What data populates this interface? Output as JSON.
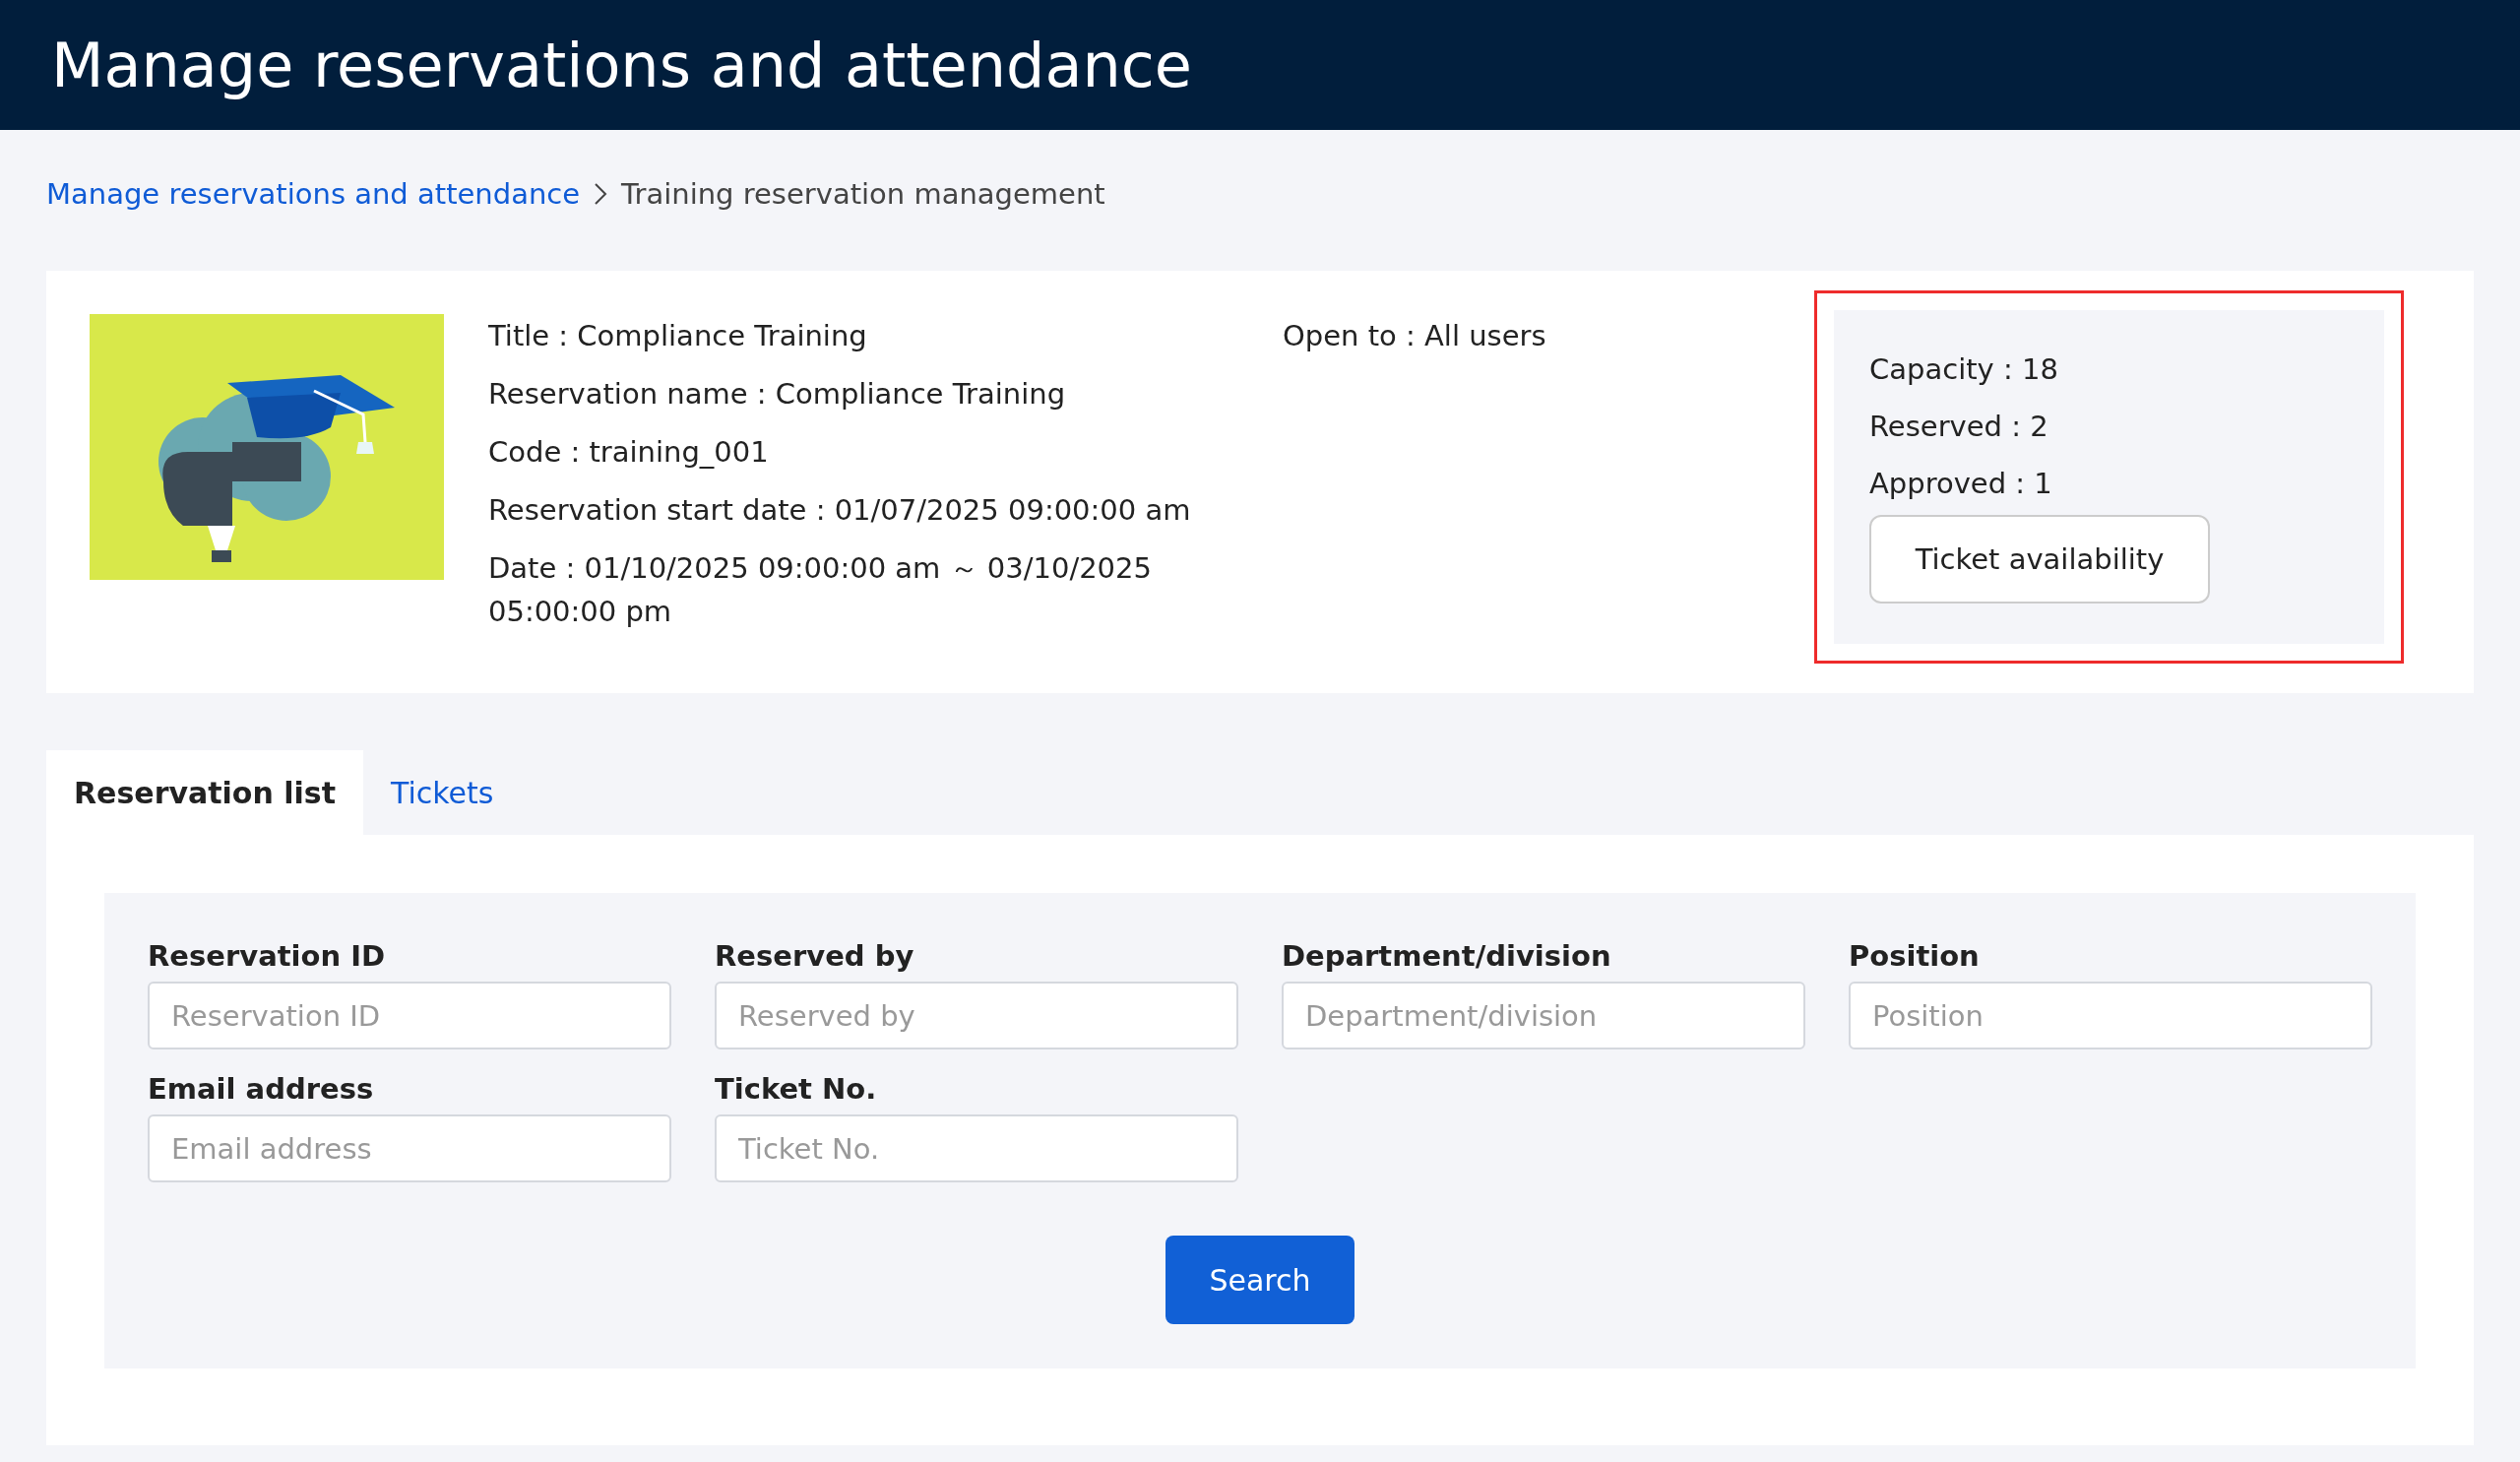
{
  "header": {
    "title": "Manage reservations and attendance"
  },
  "breadcrumb": [
    {
      "label": "Manage reservations and attendance",
      "kind": "link"
    },
    {
      "label": "Training reservation management",
      "kind": "current"
    }
  ],
  "details": {
    "fields": [
      "Title : Compliance Training",
      "Reservation name : Compliance Training",
      "Code : training_001",
      "Reservation start date : 01/07/2025 09:00:00 am",
      "Date : 01/10/2025 09:00:00 am ～ 03/10/2025 05:00:00 pm"
    ],
    "open_to": "Open to : All users"
  },
  "stats": {
    "items": [
      "Capacity : 18",
      "Reserved : 2",
      "Approved : 1"
    ],
    "button": "Ticket availability"
  },
  "tabs": [
    {
      "label": "Reservation list",
      "selected": true
    },
    {
      "label": "Tickets",
      "selected": false
    }
  ],
  "search_form": {
    "fields": [
      {
        "label": "Reservation ID",
        "placeholder": "Reservation ID"
      },
      {
        "label": "Reserved by",
        "placeholder": "Reserved by"
      },
      {
        "label": "Department/division",
        "placeholder": "Department/division"
      },
      {
        "label": "Position",
        "placeholder": "Position"
      },
      {
        "label": "Email address",
        "placeholder": "Email address"
      },
      {
        "label": "Ticket No.",
        "placeholder": "Ticket No."
      }
    ],
    "button": "Search"
  }
}
